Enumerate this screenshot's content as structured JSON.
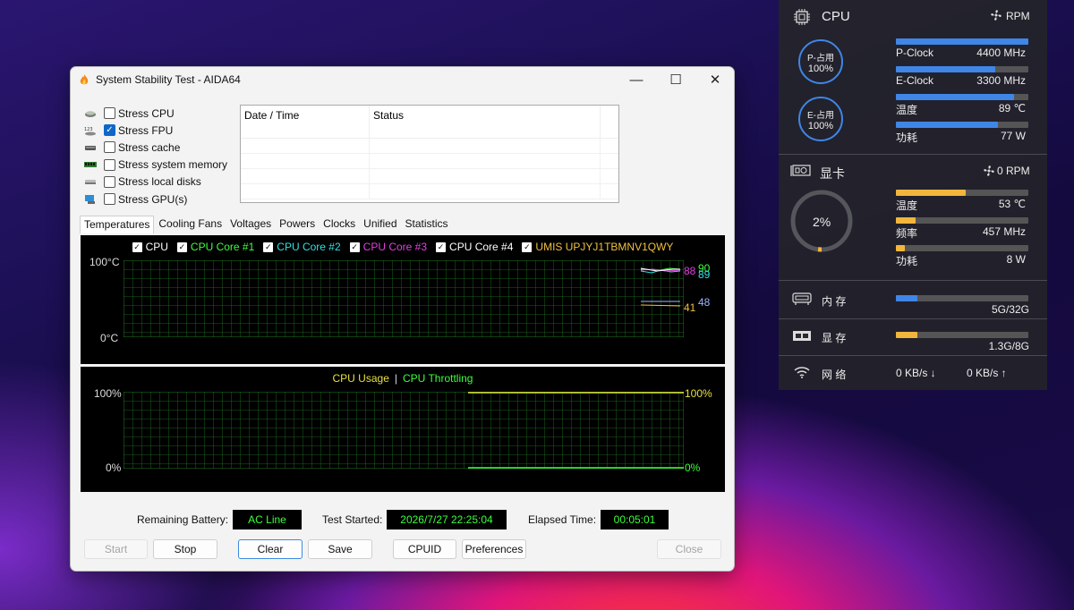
{
  "window": {
    "title": "System Stability Test - AIDA64",
    "minimize": "—",
    "maximize": "☐",
    "close": "✕"
  },
  "stress_options": [
    {
      "label": "Stress CPU",
      "checked": false,
      "icon": "cpu-chip-icon"
    },
    {
      "label": "Stress FPU",
      "checked": true,
      "icon": "fpu-icon"
    },
    {
      "label": "Stress cache",
      "checked": false,
      "icon": "cache-icon"
    },
    {
      "label": "Stress system memory",
      "checked": false,
      "icon": "memory-module-icon"
    },
    {
      "label": "Stress local disks",
      "checked": false,
      "icon": "disk-icon"
    },
    {
      "label": "Stress GPU(s)",
      "checked": false,
      "icon": "gpu-monitor-icon"
    }
  ],
  "log": {
    "col_datetime": "Date / Time",
    "col_status": "Status"
  },
  "tabs": [
    "Temperatures",
    "Cooling Fans",
    "Voltages",
    "Powers",
    "Clocks",
    "Unified",
    "Statistics"
  ],
  "active_tab": "Temperatures",
  "temp_graph": {
    "legend": [
      {
        "label": "CPU",
        "color": "#ffffff"
      },
      {
        "label": "CPU Core #1",
        "color": "#3dff3d"
      },
      {
        "label": "CPU Core #2",
        "color": "#30e0e0"
      },
      {
        "label": "CPU Core #3",
        "color": "#e040e0"
      },
      {
        "label": "CPU Core #4",
        "color": "#ffffff"
      },
      {
        "label": "UMIS UPJYJ1TBMNV1QWY",
        "color": "#f0c040"
      }
    ],
    "y_max": "100°C",
    "y_min": "0°C",
    "end_values": [
      {
        "text": "88",
        "color": "#e040e0"
      },
      {
        "text": "90",
        "color": "#3dff3d"
      },
      {
        "text": "89",
        "color": "#30e0e0"
      },
      {
        "text": "48",
        "color": "#9fb4ff"
      },
      {
        "text": "41",
        "color": "#f0c040"
      }
    ]
  },
  "usage_graph": {
    "legend_usage": "CPU Usage",
    "legend_sep": "|",
    "legend_throttling": "CPU Throttling",
    "y_max_left": "100%",
    "y_min_left": "0%",
    "y_max_right": "100%",
    "y_min_right": "0%"
  },
  "status_bar": {
    "battery_label": "Remaining Battery:",
    "battery_value": "AC Line",
    "started_label": "Test Started:",
    "started_value": "2026/7/27 22:25:04",
    "elapsed_label": "Elapsed Time:",
    "elapsed_value": "00:05:01"
  },
  "buttons": {
    "start": "Start",
    "stop": "Stop",
    "clear": "Clear",
    "save": "Save",
    "cpuid": "CPUID",
    "preferences": "Preferences",
    "close": "Close"
  },
  "monitor": {
    "cpu": {
      "title": "CPU",
      "fan": "RPM",
      "p_ring_label": "P-占用",
      "p_ring_value": "100%",
      "e_ring_label": "E-占用",
      "e_ring_value": "100%",
      "rows": [
        {
          "label": "P-Clock",
          "value": "4400 MHz",
          "fill": 1.0
        },
        {
          "label": "E-Clock",
          "value": "3300 MHz",
          "fill": 0.75
        },
        {
          "label": "温度",
          "value": "89 ℃",
          "fill": 0.89
        },
        {
          "label": "功耗",
          "value": "77 W",
          "fill": 0.77
        }
      ]
    },
    "gpu": {
      "title": "显卡",
      "fan": "0 RPM",
      "ring_value": "2%",
      "ring_fill": 0.02,
      "rows": [
        {
          "label": "温度",
          "value": "53 ℃",
          "fill": 0.53
        },
        {
          "label": "频率",
          "value": "457 MHz",
          "fill": 0.15
        },
        {
          "label": "功耗",
          "value": "8 W",
          "fill": 0.07
        }
      ]
    },
    "memory": {
      "label": "内 存",
      "value": "5G/32G",
      "fill": 0.16
    },
    "vram": {
      "label": "显 存",
      "value": "1.3G/8G",
      "fill": 0.16
    },
    "network": {
      "label": "网 络",
      "down": "0 KB/s ↓",
      "up": "0 KB/s ↑"
    },
    "colors": {
      "cpu_bar": "#3f86e6",
      "gpu_bar": "#f2b63c"
    }
  }
}
